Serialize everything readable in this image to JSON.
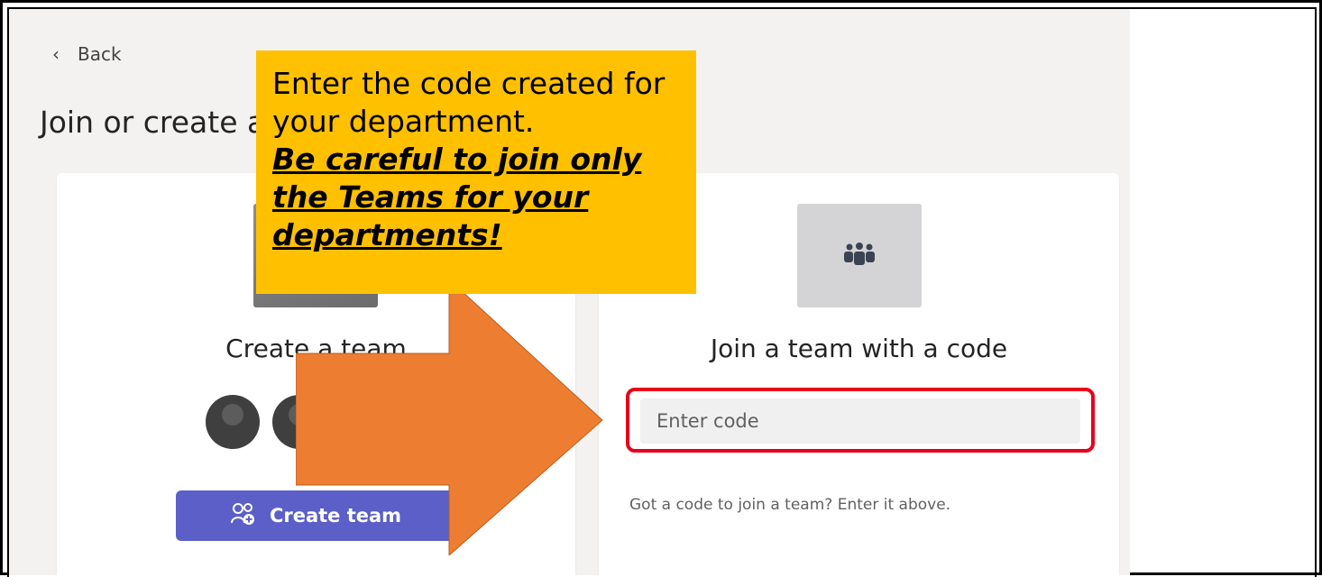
{
  "nav": {
    "back_label": "Back"
  },
  "page": {
    "title": "Join or create a team"
  },
  "create_card": {
    "title": "Create a team",
    "button_label": "Create team"
  },
  "join_card": {
    "title": "Join a team with a code",
    "input_placeholder": "Enter code",
    "hint": "Got a code to join a team? Enter it above."
  },
  "callout": {
    "text": "Enter the code created for your department.",
    "warning": "Be careful to join only the Teams for your departments!"
  },
  "colors": {
    "accent": "#5b5fc7",
    "highlight_border": "#e8001c",
    "callout_bg": "#ffc000",
    "arrow": "#ed7d31"
  },
  "icons": {
    "back": "chevron-left-icon",
    "team": "people-team-icon",
    "create": "people-add-icon"
  }
}
